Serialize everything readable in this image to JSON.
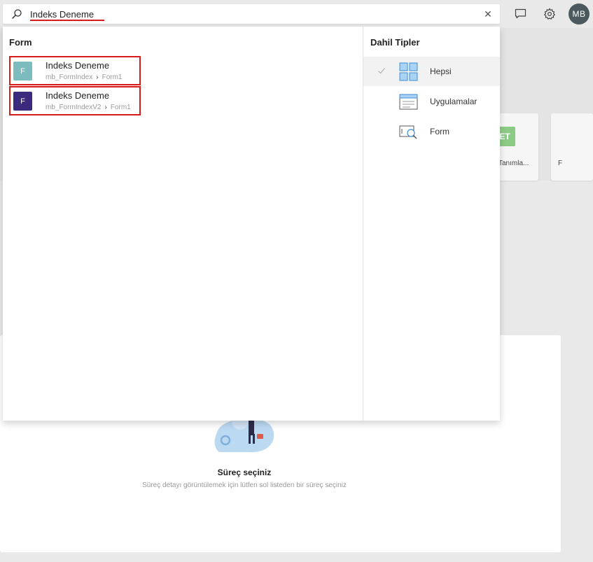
{
  "search": {
    "value": "Indeks Deneme"
  },
  "header": {
    "avatar_initials": "MB",
    "icons": [
      "search-icon",
      "clear-icon",
      "chat-icon",
      "gear-icon"
    ]
  },
  "results": {
    "heading": "Form",
    "items": [
      {
        "badge": "F",
        "badge_color": "#7cbcbf",
        "title": "Indeks Deneme",
        "path_app": "mb_FormIndex",
        "path_form": "Form1"
      },
      {
        "badge": "F",
        "badge_color": "#3b2a7e",
        "title": "Indeks Deneme",
        "path_app": "mb_FormIndexV2",
        "path_form": "Form1"
      }
    ]
  },
  "types": {
    "heading": "Dahil Tipler",
    "items": [
      {
        "label": "Hepsi",
        "icon": "grid-icon",
        "selected": true
      },
      {
        "label": "Uygulamalar",
        "icon": "app-window-icon",
        "selected": false
      },
      {
        "label": "Form",
        "icon": "form-search-icon",
        "selected": false
      }
    ]
  },
  "background": {
    "card_badge": "ET",
    "card_label": "Tanımla...",
    "card2_label": "F",
    "empty_title": "Süreç seçiniz",
    "empty_subtitle": "Süreç detayı görüntülemek için lütfen sol listeden bir süreç seçiniz"
  },
  "colors": {
    "highlight_border": "#d81b1b",
    "accent": "#4a90d9"
  }
}
